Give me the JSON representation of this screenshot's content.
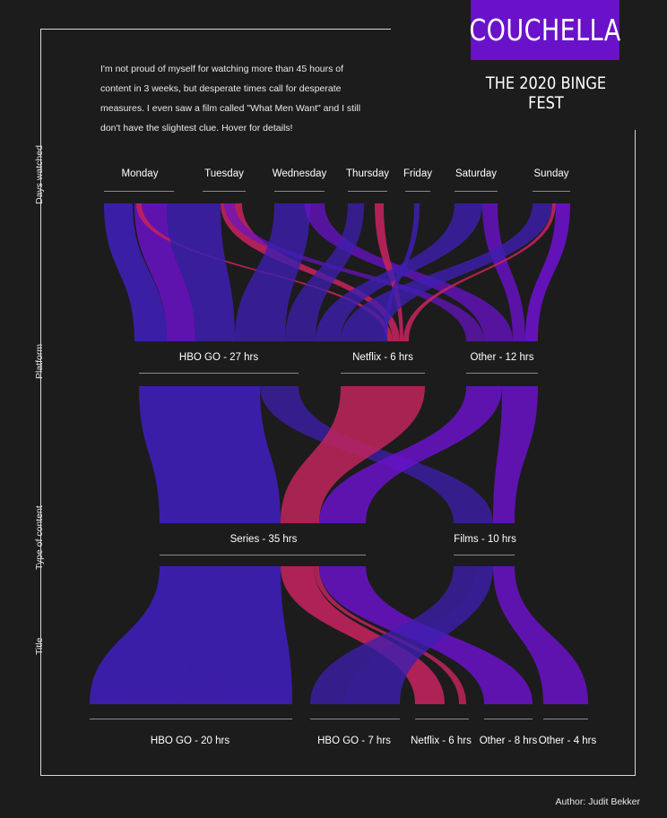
{
  "header": {
    "title": "COUCHELLA",
    "subtitle": "THE 2020 BINGE FEST",
    "intro": "I'm not proud of myself for watching more than 45 hours of content in 3 weeks, but desperate times call for desperate measures. I even saw a film called \"What Men Want\" and I still don't have the slightest clue. Hover for details!"
  },
  "axis_labels": [
    "Days watched",
    "Platform",
    "Type of content",
    "Title"
  ],
  "days": [
    "Monday",
    "Tuesday",
    "Wednesday",
    "Thursday",
    "Friday",
    "Saturday",
    "Sunday"
  ],
  "platforms": [
    "HBO GO - 27 hrs",
    "Netflix - 6 hrs",
    "Other - 12 hrs"
  ],
  "content_types": [
    "Series - 35 hrs",
    "Films - 10 hrs"
  ],
  "titles": [
    "HBO GO - 20 hrs",
    "HBO GO - 7 hrs",
    "Netflix - 6 hrs",
    "Other - 8 hrs",
    "Other - 4 hrs"
  ],
  "footer": {
    "author": "Author: Judit Bekker"
  },
  "colors": {
    "background": "#1c1c1c",
    "hbo": "#3d1fb0",
    "netflix": "#c0245c",
    "other": "#6a12c9",
    "title_box": "#6a12c9"
  }
}
